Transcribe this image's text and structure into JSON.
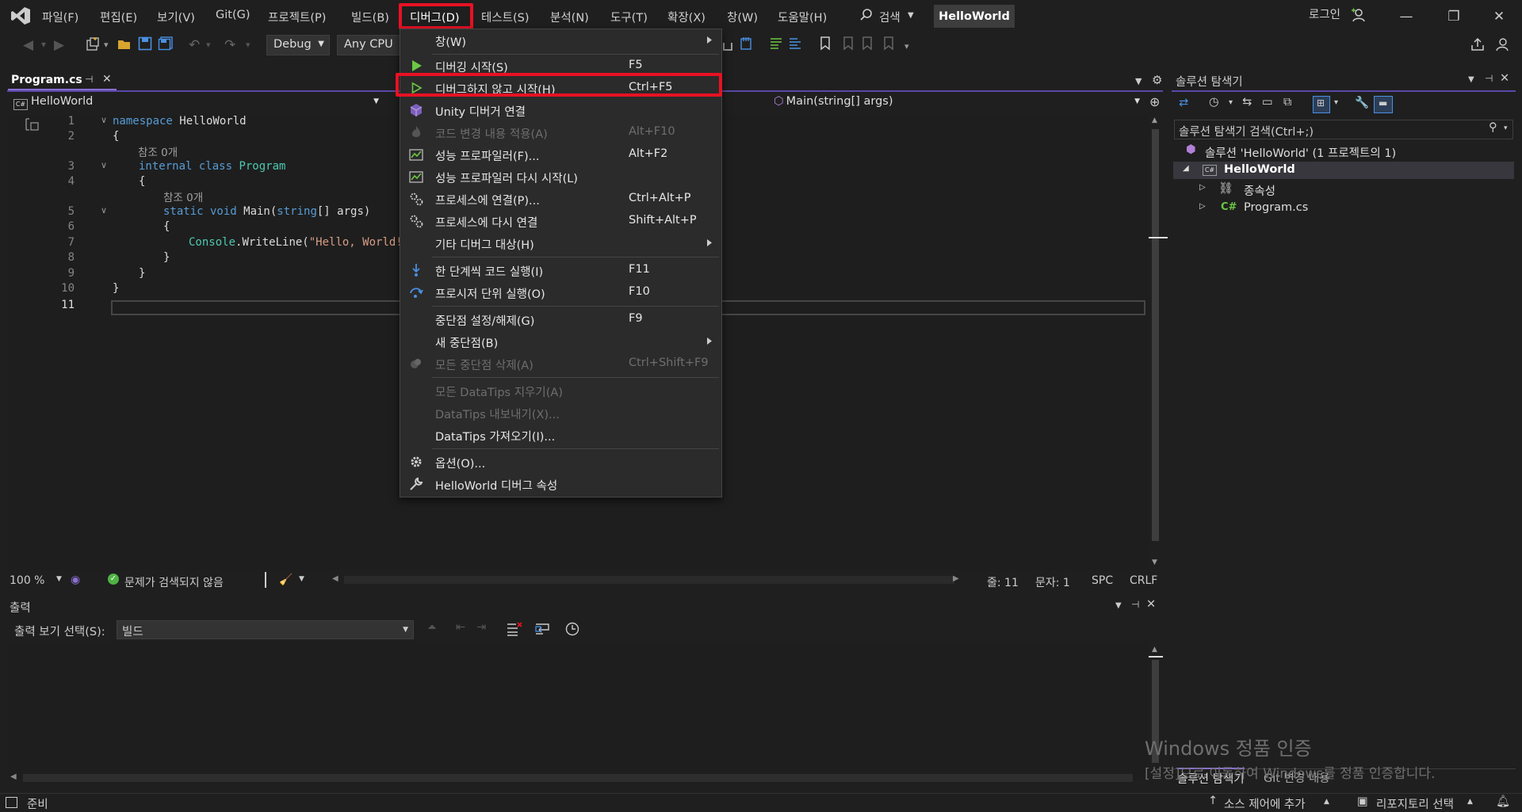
{
  "menubar": {
    "items": [
      "파일(F)",
      "편집(E)",
      "보기(V)",
      "Git(G)",
      "프로젝트(P)",
      "빌드(B)",
      "디버그(D)",
      "테스트(S)",
      "분석(N)",
      "도구(T)",
      "확장(X)",
      "창(W)",
      "도움말(H)"
    ],
    "search_label": "검색",
    "project_name": "HelloWorld",
    "login_label": "로그인"
  },
  "toolbar": {
    "config": "Debug",
    "platform": "Any CPU"
  },
  "editor": {
    "tab_title": "Program.cs",
    "nav_project": "HelloWorld",
    "nav_member": "Main(string[] args)",
    "line_numbers": [
      "1",
      "2",
      "3",
      "4",
      "5",
      "6",
      "7",
      "8",
      "9",
      "10",
      "11"
    ],
    "code": {
      "l1_kw": "namespace",
      "l1_name": " HelloWorld",
      "l2": "{",
      "ref1": "참조 0개",
      "l3_kw": "internal class",
      "l3_name": "Program",
      "l4": "{",
      "ref2": "참조 0개",
      "l5_kw": "static void",
      "l5_rest": " Main(",
      "l5_kw2": "string",
      "l5_rest2": "[] args)",
      "l6": "{",
      "l7_ty": "Console",
      "l7_rest": ".WriteLine(",
      "l7_str": "\"Hello, World!\");",
      "l8": "}",
      "l9": "}",
      "l10": "}"
    },
    "status": {
      "zoom": "100 %",
      "issues": "문제가 검색되지 않음",
      "line": "줄: 11",
      "col": "문자: 1",
      "spc": "SPC",
      "crlf": "CRLF"
    }
  },
  "output": {
    "title": "출력",
    "select_label": "출력 보기 선택(S):",
    "select_value": "빌드"
  },
  "solution_explorer": {
    "title": "솔루션 탐색기",
    "search_placeholder": "솔루션 탐색기 검색(Ctrl+;)",
    "solution": "솔루션 'HelloWorld' (1 프로젝트의 1)",
    "project": "HelloWorld",
    "dependencies": "종속성",
    "file": "Program.cs",
    "bottom_tab_active": "솔루션 탐색기",
    "bottom_tab_other": "Git 변경 내용"
  },
  "debug_menu": {
    "items": [
      {
        "label": "창(W)",
        "shortcut": "",
        "submenu": true,
        "disabled": false,
        "icon": "none"
      },
      {
        "label": "디버깅 시작(S)",
        "shortcut": "F5",
        "submenu": false,
        "disabled": false,
        "icon": "play-filled-icon"
      },
      {
        "label": "디버그하지 않고 시작(H)",
        "shortcut": "Ctrl+F5",
        "submenu": false,
        "disabled": false,
        "icon": "play-outline-icon"
      },
      {
        "label": "Unity 디버거 연결",
        "shortcut": "",
        "submenu": false,
        "disabled": false,
        "icon": "unity-cube-icon"
      },
      {
        "label": "코드 변경 내용 적용(A)",
        "shortcut": "Alt+F10",
        "submenu": false,
        "disabled": true,
        "icon": "flame-icon"
      },
      {
        "label": "성능 프로파일러(F)...",
        "shortcut": "Alt+F2",
        "submenu": false,
        "disabled": false,
        "icon": "profiler-icon"
      },
      {
        "label": "성능 프로파일러 다시 시작(L)",
        "shortcut": "",
        "submenu": false,
        "disabled": false,
        "icon": "profiler-icon"
      },
      {
        "label": "프로세스에 연결(P)...",
        "shortcut": "Ctrl+Alt+P",
        "submenu": false,
        "disabled": false,
        "icon": "gears-icon"
      },
      {
        "label": "프로세스에 다시 연결",
        "shortcut": "Shift+Alt+P",
        "submenu": false,
        "disabled": false,
        "icon": "gears-icon"
      },
      {
        "label": "기타 디버그 대상(H)",
        "shortcut": "",
        "submenu": true,
        "disabled": false,
        "icon": "none"
      },
      {
        "label": "한 단계씩 코드 실행(I)",
        "shortcut": "F11",
        "submenu": false,
        "disabled": false,
        "icon": "step-into-icon"
      },
      {
        "label": "프로시저 단위 실행(O)",
        "shortcut": "F10",
        "submenu": false,
        "disabled": false,
        "icon": "step-over-icon"
      },
      {
        "label": "중단점 설정/해제(G)",
        "shortcut": "F9",
        "submenu": false,
        "disabled": false,
        "icon": "none"
      },
      {
        "label": "새 중단점(B)",
        "shortcut": "",
        "submenu": true,
        "disabled": false,
        "icon": "none"
      },
      {
        "label": "모든 중단점 삭제(A)",
        "shortcut": "Ctrl+Shift+F9",
        "submenu": false,
        "disabled": true,
        "icon": "breakpoints-icon"
      },
      {
        "label": "모든 DataTips 지우기(A)",
        "shortcut": "",
        "submenu": false,
        "disabled": true,
        "icon": "none"
      },
      {
        "label": "DataTips 내보내기(X)...",
        "shortcut": "",
        "submenu": false,
        "disabled": true,
        "icon": "none"
      },
      {
        "label": "DataTips 가져오기(I)...",
        "shortcut": "",
        "submenu": false,
        "disabled": false,
        "icon": "none"
      },
      {
        "label": "옵션(O)...",
        "shortcut": "",
        "submenu": false,
        "disabled": false,
        "icon": "gear-icon"
      },
      {
        "label": "HelloWorld 디버그 속성",
        "shortcut": "",
        "submenu": false,
        "disabled": false,
        "icon": "wrench-icon"
      }
    ]
  },
  "statusbar": {
    "ready": "준비",
    "source_control": "소스 제어에 추가",
    "repo": "리포지토리 선택"
  },
  "watermark": {
    "title": "Windows 정품 인증",
    "subtitle": "[설정]으로 이동하여 Windows를 정품 인증합니다."
  },
  "colors": {
    "accent": "#8a6fd1",
    "highlight": "#e81123",
    "play": "#6cc644",
    "keyword": "#569cd6",
    "type": "#4ec9b0",
    "string": "#d69d85"
  }
}
